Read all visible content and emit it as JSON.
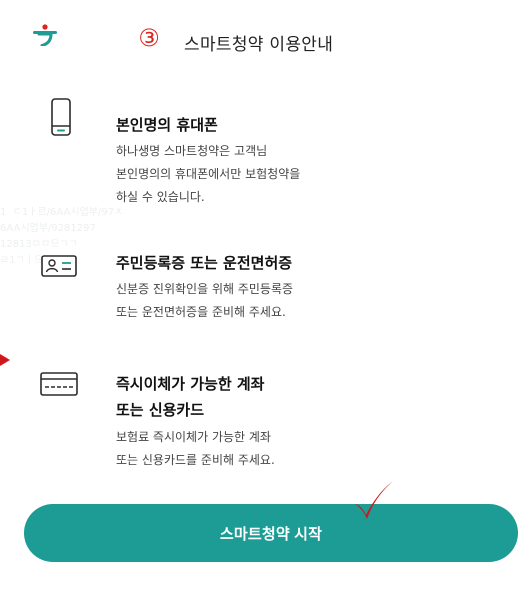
{
  "header": {
    "logo_icon": "hana-logo-icon",
    "step_number": "③",
    "title": "스마트청약 이용안내"
  },
  "sections": [
    {
      "icon": "mobile-phone-icon",
      "title": "본인명의 휴대폰",
      "description": [
        "하나생명 스마트청약은 고객님",
        "본인명의의 휴대폰에서만 보험청약을",
        "하실 수 있습니다."
      ]
    },
    {
      "icon": "id-card-icon",
      "title": "주민등록증 또는 운전면허증",
      "description": [
        "신분증 진위확인을 위해 주민등록증",
        "또는 운전면허증을 준비해 주세요."
      ]
    },
    {
      "icon": "credit-card-icon",
      "title_lines": [
        "즉시이체가 가능한 계좌",
        "또는 신용카드"
      ],
      "description": [
        "보험료 즉시이체가 가능한 계좌",
        "또는 신용카드를 준비해 주세요."
      ]
    }
  ],
  "start_button": {
    "label": "스마트청약 시작"
  },
  "colors": {
    "brand_green": "#1d9c95",
    "accent_red": "#e0231b",
    "check_red": "#d0161b"
  }
}
